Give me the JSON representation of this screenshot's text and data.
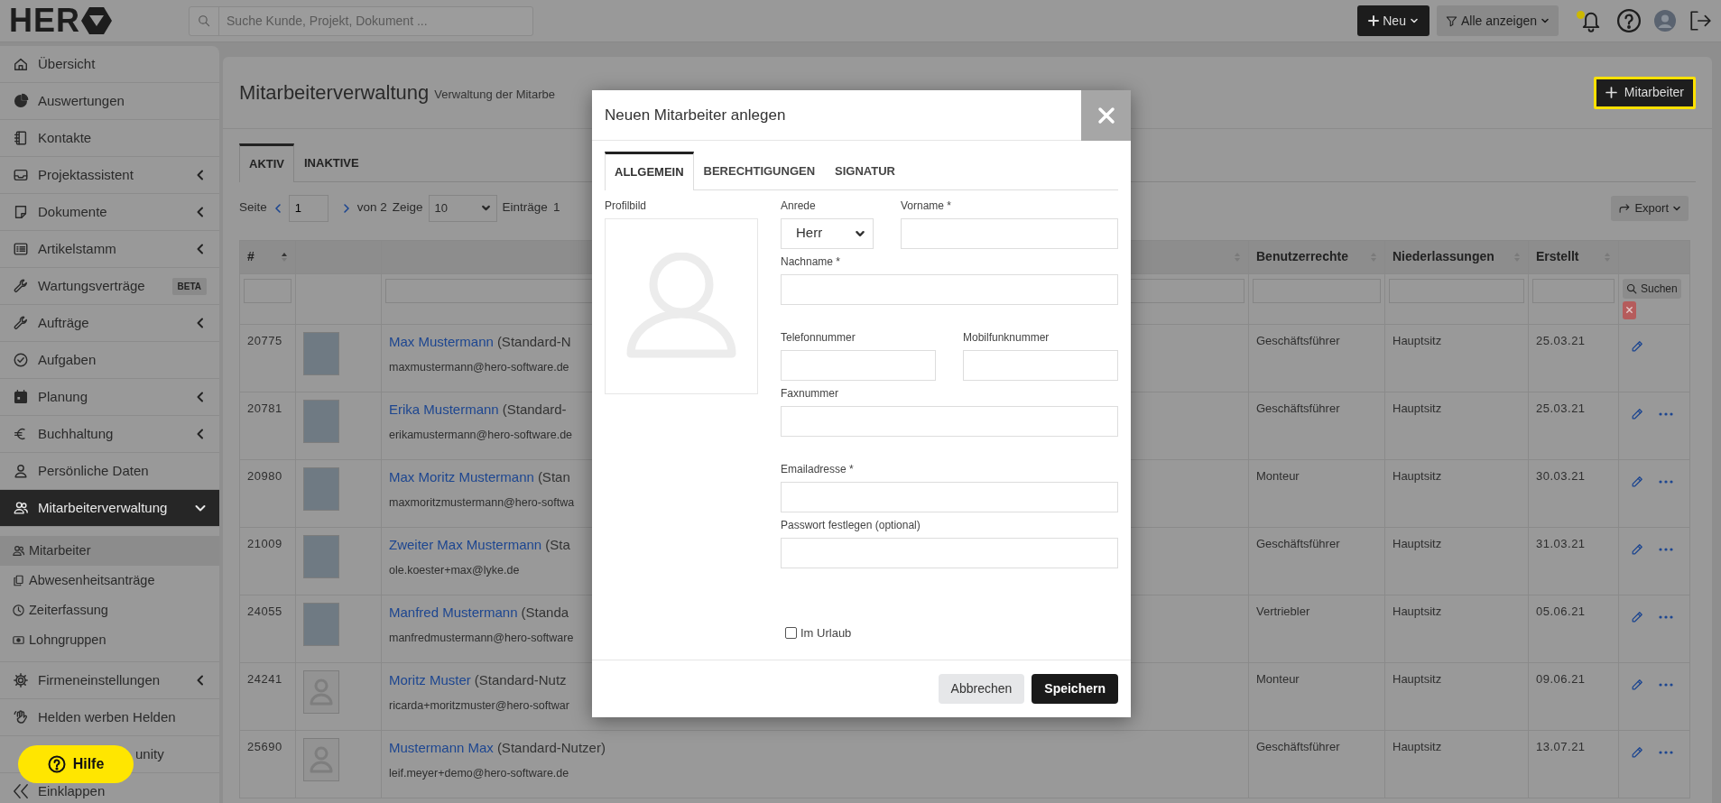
{
  "topbar": {
    "logo_text": "HER",
    "search": {
      "placeholder": "Suche Kunde, Projekt, Dokument ..."
    },
    "new_button": "Neu",
    "filter_button": "Alle anzeigen",
    "notification_dot": true
  },
  "sidebar": {
    "items": [
      {
        "label": "Übersicht",
        "selected": false
      },
      {
        "label": "Auswertungen",
        "selected": false
      },
      {
        "label": "Kontakte",
        "selected": false
      },
      {
        "label": "Projektassistent",
        "selected": false,
        "expanded": false
      },
      {
        "label": "Dokumente",
        "selected": false,
        "expanded": false
      },
      {
        "label": "Artikelstamm",
        "selected": false,
        "expanded": false
      },
      {
        "label": "Wartungsverträge",
        "selected": false,
        "badge": "BETA"
      },
      {
        "label": "Aufträge",
        "selected": false,
        "expanded": false
      },
      {
        "label": "Aufgaben",
        "selected": false
      },
      {
        "label": "Planung",
        "selected": false,
        "expanded": false
      },
      {
        "label": "Buchhaltung",
        "selected": false,
        "expanded": false
      },
      {
        "label": "Persönliche Daten",
        "selected": false
      },
      {
        "label": "Mitarbeiterverwaltung",
        "selected": true,
        "expanded": true,
        "children": [
          {
            "label": "Mitarbeiter",
            "selected": true
          },
          {
            "label": "Abwesenheitsanträge",
            "selected": false
          },
          {
            "label": "Zeiterfassung",
            "selected": false
          },
          {
            "label": "Lohngruppen",
            "selected": false
          }
        ]
      },
      {
        "label": "Firmeneinstellungen",
        "selected": false,
        "expanded": false
      },
      {
        "label": "Helden werben Helden",
        "selected": false
      },
      {
        "label": "unity",
        "selected": false
      },
      {
        "label": "Einklappen",
        "selected": false
      }
    ],
    "help_button": "Hilfe"
  },
  "page": {
    "title": "Mitarbeiterverwaltung",
    "subtitle": "Verwaltung der Mitarbe",
    "add_button": "Mitarbeiter",
    "tabs": [
      {
        "label": "AKTIV",
        "selected": true
      },
      {
        "label": "INAKTIVE",
        "selected": false
      }
    ],
    "pagination": {
      "page_label": "Seite",
      "page": "1",
      "of_label": "von 2",
      "show_label": "Zeige",
      "page_size": "10",
      "entries_label": "Einträge",
      "count": "1"
    },
    "export_button": "Export"
  },
  "table": {
    "columns": [
      {
        "label": "#",
        "sorted": true,
        "filter": true
      },
      {
        "filter": false
      },
      {
        "sorted": false,
        "filter": true
      },
      {
        "label": "Benutzerrechte",
        "sorted": false,
        "filter": true
      },
      {
        "label": "Niederlassungen",
        "sorted": false,
        "filter": true
      },
      {
        "label": "Erstellt",
        "sorted": false,
        "filter": true
      },
      {
        "filter": false
      }
    ],
    "search_button": "Suchen",
    "rows": [
      {
        "id": "20775",
        "kind": "photo",
        "name": "Max Mustermann",
        "role": "(Standard-N",
        "email": "maxmustermann@hero-software.de",
        "rights": "Geschäftsführer",
        "branch": "Hauptsitz",
        "created": "25.03.21",
        "more_menu": false
      },
      {
        "id": "20781",
        "kind": "photo",
        "name": "Erika Mustermann",
        "role": "(Standard-",
        "email": "erikamustermann@hero-software.de",
        "rights": "Geschäftsführer",
        "branch": "Hauptsitz",
        "created": "25.03.21",
        "more_menu": true
      },
      {
        "id": "20980",
        "kind": "photo",
        "name": "Max Moritz Mustermann",
        "role": "(Stan",
        "email": "maxmoritzmustermann@hero-softwa",
        "rights": "Monteur",
        "branch": "Hauptsitz",
        "created": "30.03.21",
        "more_menu": true
      },
      {
        "id": "21009",
        "kind": "photo",
        "name": "Zweiter Max Mustermann",
        "role": "(Sta",
        "email": "ole.koester+max@lyke.de",
        "rights": "Geschäftsführer",
        "branch": "Hauptsitz",
        "created": "31.03.21",
        "more_menu": true
      },
      {
        "id": "24055",
        "kind": "photo",
        "name": "Manfred Mustermann",
        "role": "(Standa",
        "email": "manfredmustermann@hero-software",
        "rights": "Vertriebler",
        "branch": "Hauptsitz",
        "created": "05.06.21",
        "more_menu": true
      },
      {
        "id": "24241",
        "kind": "default",
        "name": "Moritz Muster",
        "role": "(Standard-Nutz",
        "email": "ricarda+moritzmuster@hero-softwar",
        "rights": "Monteur",
        "branch": "Hauptsitz",
        "created": "09.06.21",
        "more_menu": true
      },
      {
        "id": "25690",
        "kind": "default",
        "name": "Mustermann Max",
        "role": "(Standard-Nutzer)",
        "email": "leif.meyer+demo@hero-software.de",
        "rights": "Geschäftsführer",
        "branch": "Hauptsitz",
        "created": "13.07.21",
        "more_menu": true
      }
    ]
  },
  "modal": {
    "title": "Neuen Mitarbeiter anlegen",
    "tabs": [
      {
        "label": "ALLGEMEIN",
        "selected": true
      },
      {
        "label": "BERECHTIGUNGEN",
        "selected": false
      },
      {
        "label": "SIGNATUR",
        "selected": false
      }
    ],
    "profile_label": "Profilbild",
    "field_rows": [
      [
        {
          "kind": "select",
          "label": "Anrede",
          "value": "Herr"
        },
        {
          "kind": "text",
          "label": "Vorname *"
        }
      ],
      [
        {
          "kind": "text",
          "label": "Nachname *"
        }
      ],
      [
        {
          "kind": "text",
          "label": "Telefonnummer"
        },
        {
          "kind": "text",
          "label": "Mobilfunknummer"
        }
      ],
      [
        {
          "kind": "text",
          "label": "Faxnummer"
        }
      ],
      [
        {
          "kind": "text",
          "label": "Emailadresse *"
        }
      ],
      [
        {
          "kind": "text",
          "label": "Passwort festlegen (optional)"
        }
      ]
    ],
    "checkbox": {
      "label": "Im Urlaub",
      "checked": false
    },
    "buttons": [
      {
        "label": "Abbrechen",
        "kind": "secondary"
      },
      {
        "label": "Speichern",
        "kind": "primary"
      }
    ]
  }
}
